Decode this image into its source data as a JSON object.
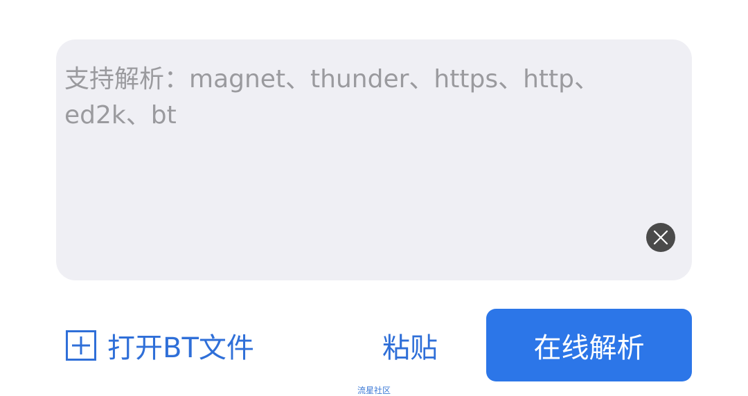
{
  "input": {
    "placeholder": "支持解析：magnet、thunder、https、http、ed2k、bt",
    "value": "",
    "clear_icon": "close-circle-icon"
  },
  "actions": {
    "open_bt_icon": "plus-box-icon",
    "open_bt_label": "打开BT文件",
    "paste_label": "粘贴",
    "parse_label": "在线解析"
  },
  "watermark": {
    "text": "流星社区"
  },
  "colors": {
    "panel_bg": "#efeff4",
    "accent": "#2c76e8",
    "link_text": "#2f6fd8",
    "placeholder": "#9a9a9e",
    "clear_button_bg": "#4a4a4a"
  }
}
